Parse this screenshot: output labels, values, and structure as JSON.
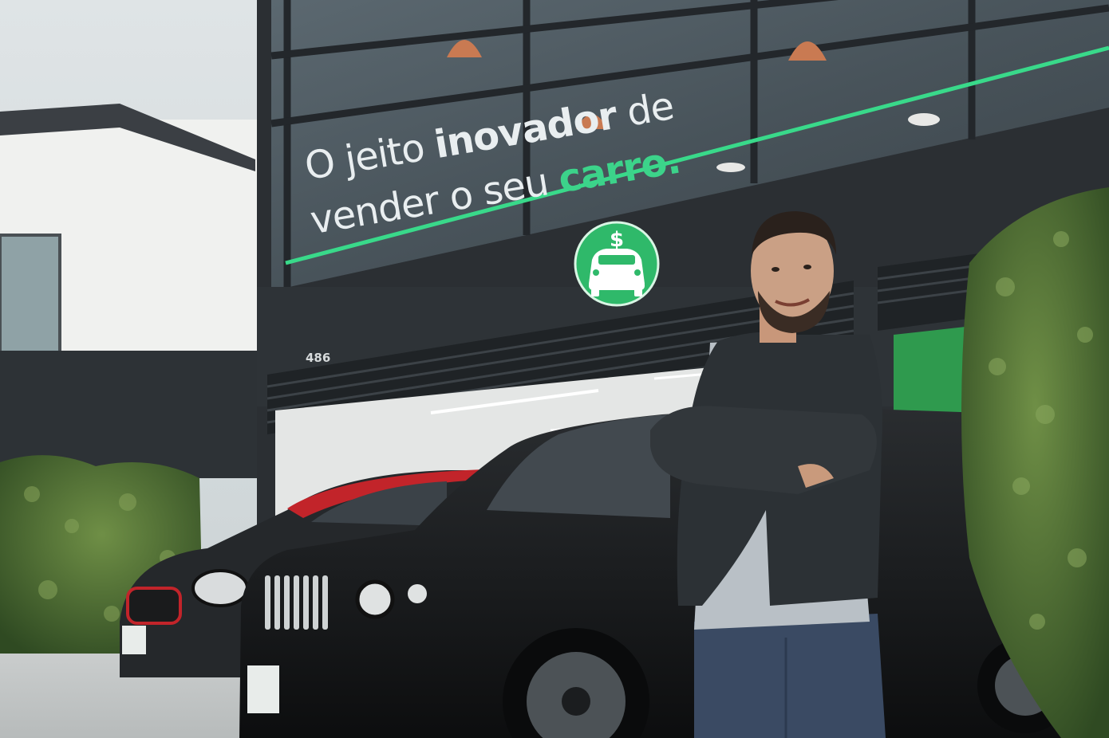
{
  "signage": {
    "line1_part1": "O jeito",
    "line1_bold": "inovador",
    "line1_part2": "de",
    "line2_part1": "vender o seu",
    "line2_highlight": "carro."
  },
  "building": {
    "house_number": "486"
  },
  "colors": {
    "brand_green": "#2fb96a",
    "neon_line": "#39d98a",
    "facade": "#2b2f33",
    "sky": "#d3dadc"
  },
  "icons": {
    "logo": "car-with-dollar-sign-icon"
  }
}
